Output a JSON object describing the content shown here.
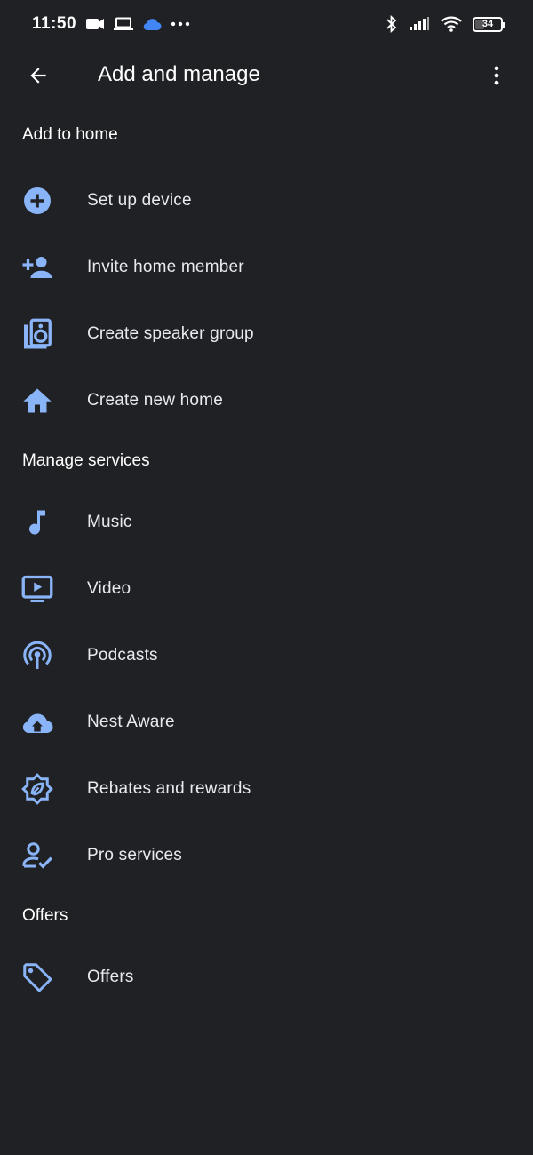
{
  "status_bar": {
    "time": "11:50",
    "battery": "34",
    "left_icons": [
      "video-camera-icon",
      "laptop-icon",
      "cloud-icon",
      "more-dots-icon"
    ],
    "right_icons": [
      "bluetooth-icon",
      "signal-icon",
      "wifi-icon"
    ]
  },
  "app_bar": {
    "title": "Add and manage",
    "back_icon": "arrow-back-icon",
    "menu_icon": "more-vert-icon"
  },
  "colors": {
    "background": "#202125",
    "accent": "#8ab4f8",
    "text": "#e8eaed"
  },
  "sections": {
    "add_to_home": {
      "header": "Add to home",
      "items": [
        {
          "label": "Set up device",
          "icon": "add-circle-icon"
        },
        {
          "label": "Invite home member",
          "icon": "person-add-icon"
        },
        {
          "label": "Create speaker group",
          "icon": "speaker-icon"
        },
        {
          "label": "Create new home",
          "icon": "home-icon"
        }
      ]
    },
    "manage_services": {
      "header": "Manage services",
      "items": [
        {
          "label": "Music",
          "icon": "music-note-icon"
        },
        {
          "label": "Video",
          "icon": "video-play-icon"
        },
        {
          "label": "Podcasts",
          "icon": "podcast-icon"
        },
        {
          "label": "Nest Aware",
          "icon": "cloud-home-icon"
        },
        {
          "label": "Rebates and rewards",
          "icon": "eco-badge-icon"
        },
        {
          "label": "Pro services",
          "icon": "person-check-icon"
        }
      ]
    },
    "offers": {
      "header": "Offers",
      "items": [
        {
          "label": "Offers",
          "icon": "tag-icon"
        }
      ]
    }
  }
}
